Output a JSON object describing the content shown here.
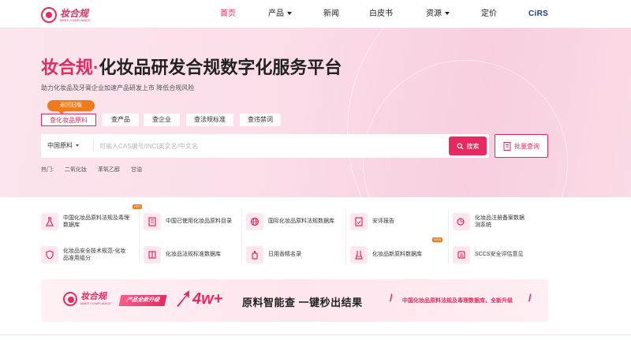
{
  "nav": {
    "logo_text": "妆合规",
    "logo_sub": "MAKE COMPLIANCE",
    "items": [
      {
        "label": "首页",
        "active": true
      },
      {
        "label": "产品",
        "dropdown": true
      },
      {
        "label": "新闻"
      },
      {
        "label": "白皮书"
      },
      {
        "label": "资源",
        "dropdown": true
      },
      {
        "label": "定价"
      }
    ],
    "cirs": "CiRS"
  },
  "hero": {
    "title_brand": "妆合规",
    "title_dot": "·",
    "title_rest": "化妆品研发合规数字化服务平台",
    "subtitle": "助力化妆品及牙膏企业加速产品研发上市 降低合规风险",
    "return_label": "返回旧版",
    "tabs": [
      "查化妆品原料",
      "查产品",
      "查企业",
      "查法规标准",
      "查违禁词"
    ],
    "search": {
      "select_value": "中国原料",
      "placeholder": "可输入CAS编号/INCI英文名/中文名",
      "button": "搜索",
      "batch": "批量查询"
    },
    "hot_label": "热门:",
    "hot_terms": [
      "二氧化钛",
      "苯氧乙醇",
      "甘油"
    ]
  },
  "features": [
    {
      "label_1": "中国化妆品原料法规及毒理",
      "label_2": "数据库",
      "icon": "flask-icon",
      "badge": "HOT"
    },
    {
      "label_1": "中国已使用化妆品原料目录",
      "label_2": "",
      "icon": "doc-icon"
    },
    {
      "label_1": "国际化妆品原料法规数据库",
      "label_2": "",
      "icon": "globe-icon"
    },
    {
      "label_1": "安评报告",
      "label_2": "",
      "icon": "report-icon"
    },
    {
      "label_1": "化妆品注册备案数据库",
      "label_2": "测系统",
      "icon": "chart-icon",
      "label_1_alt": "化妆品注册备案数据",
      "full": "化妆品注册备案数据查询系统"
    },
    {
      "label_1": "化妆品安全技术规范-化妆",
      "label_2": "品准用组分",
      "icon": "shield-icon"
    },
    {
      "label_1": "化妆品法规标准数据库",
      "label_2": "",
      "icon": "book-icon"
    },
    {
      "label_1": "日用香精名录",
      "label_2": "",
      "icon": "perfume-icon"
    },
    {
      "label_1": "化妆品新原料数据库",
      "label_2": "",
      "icon": "beaker-icon",
      "badge": "NEW"
    },
    {
      "label_1": "SCCS安全评估意见",
      "label_2": "",
      "icon": "scale-icon"
    }
  ],
  "banner": {
    "logo_text": "妆合规",
    "upgrade": "产品全新升级",
    "big": "4w+",
    "text": "原料智能查  一键秒出结果",
    "note": "中国化妆品原料法规及毒理数据库，全新升级"
  },
  "colors": {
    "accent": "#e8295f",
    "orange": "#f07a1c",
    "cirs": "#1d3b8a"
  }
}
